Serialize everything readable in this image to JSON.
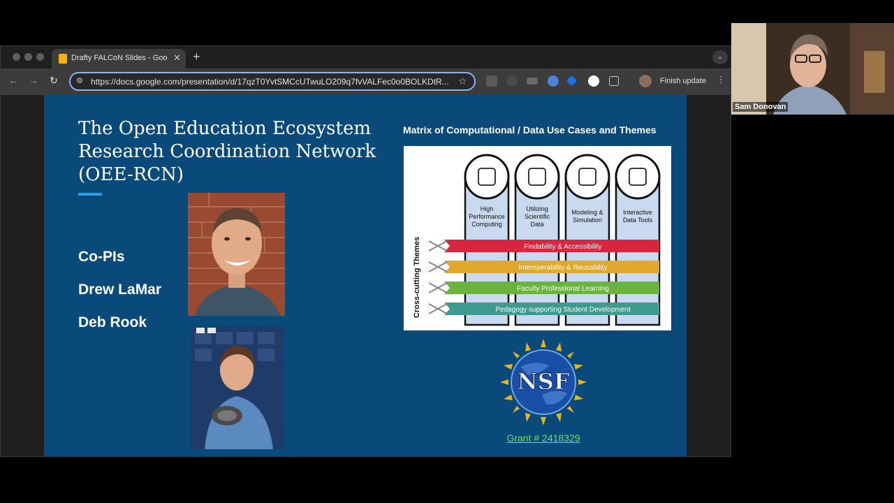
{
  "browser": {
    "tab_title": "Drafty FALCoN Slides - Goog",
    "tab_close": "✕",
    "new_tab": "+",
    "url": "https://docs.google.com/presentation/d/17qzT0YvtSMCcUTwuLO209q7fvVALFec0o0BOLKDtR...",
    "finish_update": "Finish update"
  },
  "slide": {
    "title": "The Open Education Ecosystem Research Coordination Network (OEE-RCN)",
    "people": [
      "Co-PIs",
      "Drew LaMar",
      "Deb Rook"
    ],
    "matrix_title": "Matrix of Computational / Data Use Cases and Themes",
    "matrix": {
      "columns": [
        "High Performance Computing",
        "Utilizing Scientific Data",
        "Modeling & Simulation",
        "Interactive Data Tools"
      ],
      "side_label": "Cross-cutting Themes",
      "themes": [
        {
          "label": "Findability & Accessibility",
          "color": "#d9263e"
        },
        {
          "label": "Interoperability & Reusability",
          "color": "#e0a82e"
        },
        {
          "label": "Faculty Professional Learning",
          "color": "#6bb33f"
        },
        {
          "label": "Pedagogy supporting Student Development",
          "color": "#3f9a8f"
        }
      ]
    },
    "nsf_text": "NSF",
    "grant": "Grant # 2418329"
  },
  "video": {
    "name": "Sam Donovan"
  },
  "colors": {
    "slide_bg": "#0a4a7a",
    "accent": "#2aa1e0",
    "grant_link": "#7ed957"
  }
}
